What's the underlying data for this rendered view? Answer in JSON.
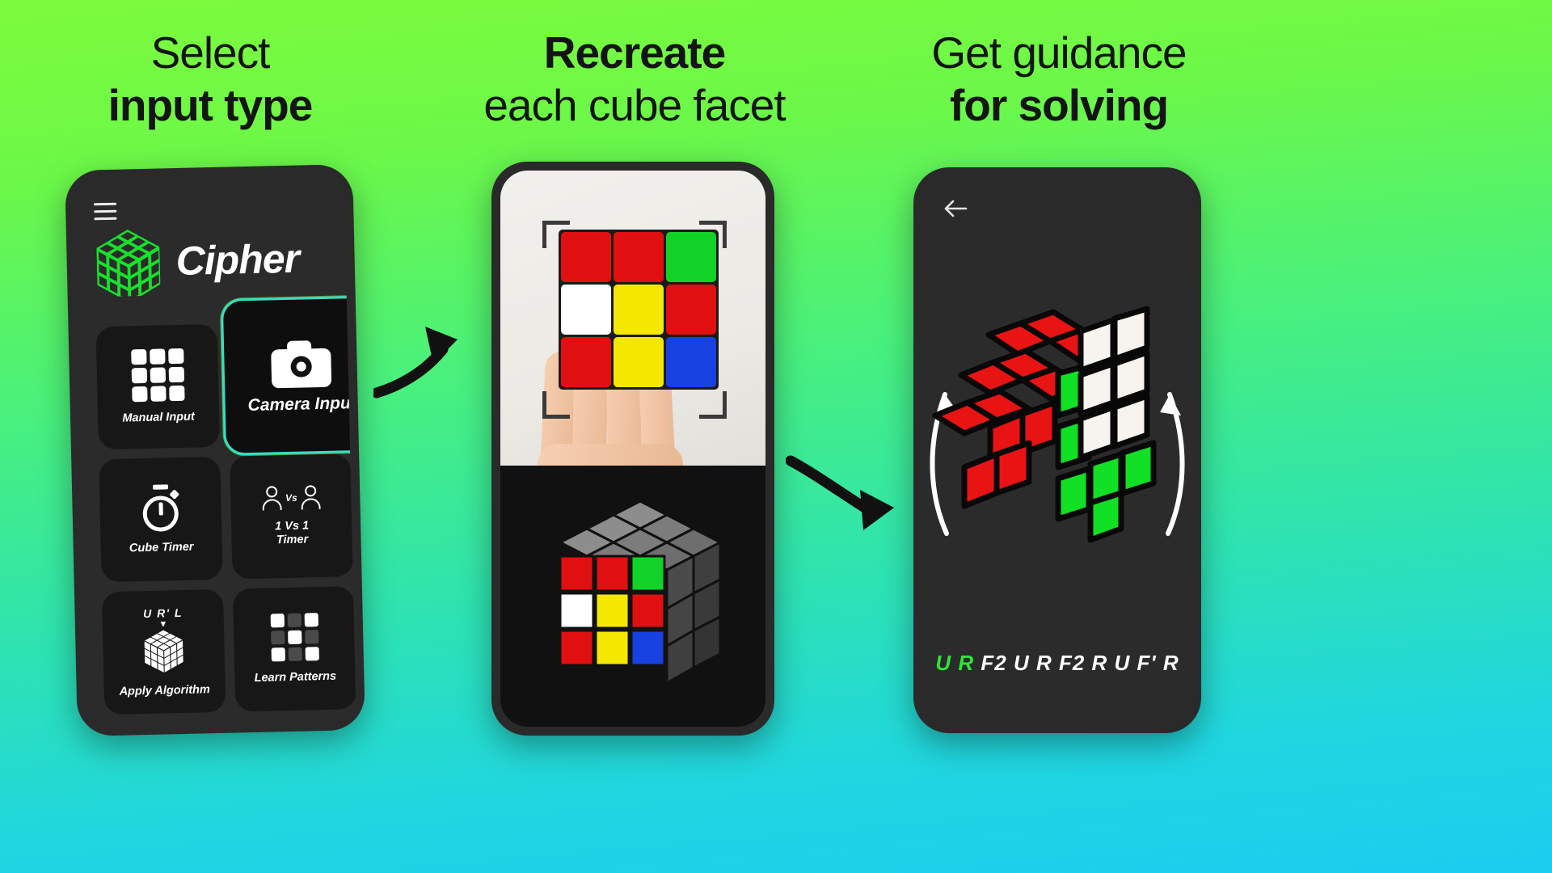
{
  "headings": [
    {
      "line1": "Select",
      "line2": "input type",
      "line1_bold": false,
      "line2_bold": true
    },
    {
      "line1": "Recreate",
      "line2": "each cube facet",
      "line1_bold": true,
      "line2_bold": false
    },
    {
      "line1": "Get guidance",
      "line2": "for solving",
      "line1_bold": false,
      "line2_bold": true
    }
  ],
  "phone1": {
    "menu_icon": "hamburger-menu-icon",
    "brand": "Cipher",
    "logo_icon": "rubiks-cube-wireframe-logo",
    "tiles": [
      {
        "label": "Manual Input",
        "icon": "grid-3x3-icon",
        "selected": false
      },
      {
        "label": "Camera Input",
        "icon": "camera-icon",
        "selected": true
      },
      {
        "label": "Cube Timer",
        "icon": "stopwatch-icon",
        "selected": false
      },
      {
        "label": "1 Vs 1\nTimer",
        "icon": "two-people-vs-icon",
        "selected": false
      },
      {
        "label": "Apply Algorithm",
        "icon": "cube-algorithm-icon",
        "selected": false
      },
      {
        "label": "Learn Patterns",
        "icon": "pattern-grid-icon",
        "selected": false
      }
    ],
    "vs_label": "Vs",
    "one_vs_one_line1": "1 Vs 1",
    "one_vs_one_line2": "Timer",
    "algorithm_hint": "U R' L",
    "highlight_color": "#34e0c4"
  },
  "phone2": {
    "camera_overlay_icon": "scan-brackets-icon",
    "face_colors": [
      [
        "#e01010",
        "#e01010",
        "#11d327"
      ],
      [
        "#ffffff",
        "#f5e800",
        "#e01010"
      ],
      [
        "#e01010",
        "#f5e800",
        "#1741e0"
      ]
    ],
    "preview_cube_front": [
      [
        "#e01010",
        "#e01010",
        "#11d327"
      ],
      [
        "#ffffff",
        "#f5e800",
        "#e01010"
      ],
      [
        "#e01010",
        "#f5e800",
        "#1741e0"
      ]
    ]
  },
  "phone3": {
    "back_icon": "arrow-left-icon",
    "rotate_icon": "rotation-arrows-icon",
    "cube_faces": {
      "left": "#e81414",
      "front": "#11e024",
      "right": "#f5f0ea"
    },
    "algorithm_done": "U R",
    "algorithm_remaining": "F2 U R F2 R U F' R",
    "done_color": "#2ee53a"
  },
  "connectors": {
    "arrow1": "curved-arrow-right",
    "arrow2": "curved-arrow-right"
  },
  "theme": {
    "bg_top": "#7dfb3c",
    "bg_bottom": "#1ccdef",
    "accent_green": "#11d327"
  }
}
